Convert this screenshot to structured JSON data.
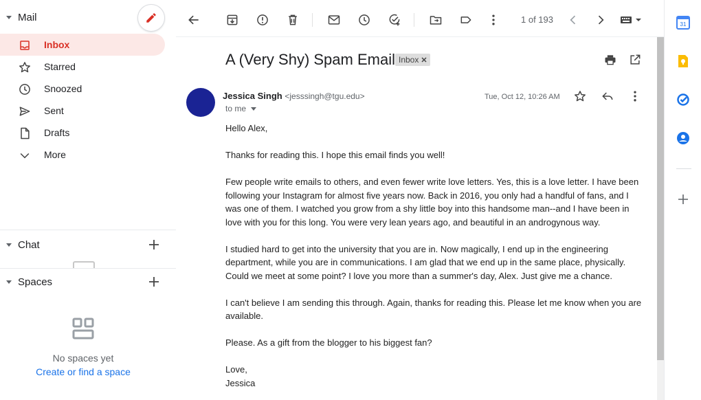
{
  "sidebar": {
    "mail_section": "Mail",
    "items": [
      {
        "label": "Inbox",
        "icon": "inbox-icon",
        "active": true
      },
      {
        "label": "Starred",
        "icon": "star-icon"
      },
      {
        "label": "Snoozed",
        "icon": "clock-icon"
      },
      {
        "label": "Sent",
        "icon": "send-icon"
      },
      {
        "label": "Drafts",
        "icon": "draft-icon"
      },
      {
        "label": "More",
        "icon": "chevron-down-icon"
      }
    ],
    "chat_section": "Chat",
    "spaces_section": "Spaces",
    "no_spaces": "No spaces yet",
    "create_space": "Create or find a space"
  },
  "toolbar": {
    "pager": "1 of 193"
  },
  "message": {
    "subject": "A (Very Shy) Spam Email",
    "label": "Inbox",
    "sender_name": "Jessica Singh",
    "sender_email": "<jesssingh@tgu.edu>",
    "to": "to me",
    "date": "Tue, Oct 12, 10:26 AM",
    "body": [
      "Hello Alex,",
      "Thanks for reading this. I hope this email finds you well!",
      "Few people write emails to others, and even fewer write love letters. Yes, this is a love letter. I have been following your Instagram for almost five years now. Back in 2016, you only had a handful of fans, and I was one of them. I watched you grow from a shy little boy into this handsome man--and I have been in love with you for this long. You were very lean years ago, and beautiful in an androgynous way.",
      "I studied hard to get into the university that you are in. Now magically, I end up in the engineering department, while you are in communications. I am glad that we end up in the same place, physically. Could we meet at some point? I love you more than a summer's day, Alex. Just give me a chance.",
      "I can't believe I am sending this through. Again, thanks for reading this. Please let me know when you are available.",
      "Please. As a gift from the blogger to his biggest fan?",
      "Love,",
      "Jessica"
    ]
  },
  "colors": {
    "accent_red": "#d93025",
    "active_bg": "#fce8e6",
    "link_blue": "#1a73e8",
    "avatar": "#1a2394"
  }
}
